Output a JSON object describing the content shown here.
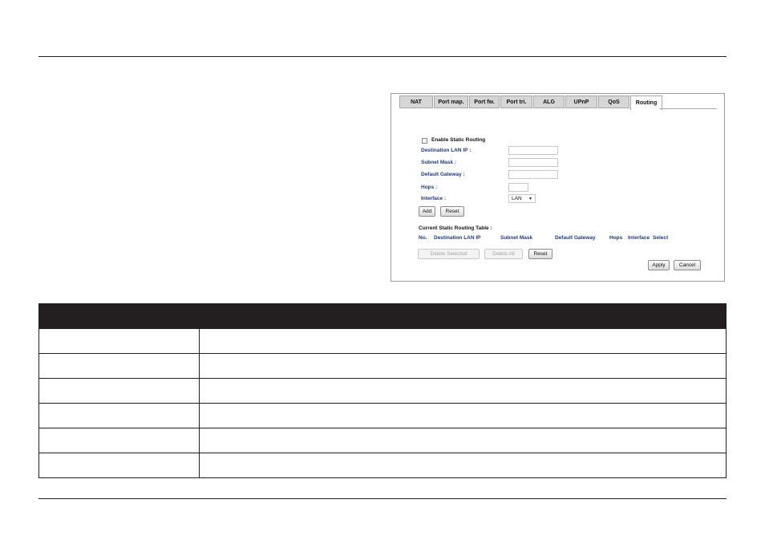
{
  "tabs": [
    {
      "label": "NAT",
      "active": false
    },
    {
      "label": "Port map.",
      "active": false
    },
    {
      "label": "Port fw.",
      "active": false
    },
    {
      "label": "Port tri.",
      "active": false
    },
    {
      "label": "ALG",
      "active": false
    },
    {
      "label": "UPnP",
      "active": false
    },
    {
      "label": "QoS",
      "active": false
    },
    {
      "label": "Routing",
      "active": true
    }
  ],
  "form": {
    "enable_label": "Enable Static Routing",
    "destination_label": "Destination LAN IP :",
    "subnet_label": "Subnet Mask :",
    "gateway_label": "Default Gateway :",
    "hops_label": "Hops :",
    "interface_label": "Interface :",
    "interface_value": "LAN",
    "add_label": "Add",
    "reset_label": "Reset"
  },
  "routing_table": {
    "title": "Current Static Routing Table :",
    "columns": [
      "No.",
      "Destination LAN IP",
      "Subnet Mask",
      "Default Gateway",
      "Hops",
      "Interface",
      "Select"
    ]
  },
  "actions": {
    "delete_selected": "Delete Selected",
    "delete_all": "Delete All",
    "reset": "Reset",
    "apply": "Apply",
    "cancel": "Cancel"
  },
  "doc_table_rows": 6
}
